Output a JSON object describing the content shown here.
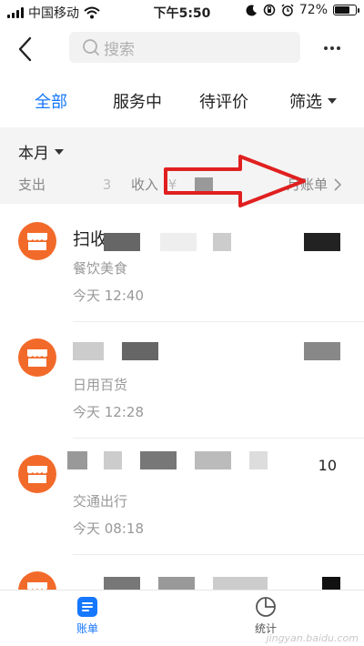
{
  "status_bar": {
    "carrier": "中国移动",
    "time": "下午5:50",
    "battery": "72%",
    "battery_level": 0.72
  },
  "search": {
    "placeholder": "搜索"
  },
  "tabs": [
    {
      "label": "全部",
      "active": true
    },
    {
      "label": "服务中"
    },
    {
      "label": "待评价"
    },
    {
      "label": "筛选"
    }
  ],
  "month": {
    "title": "本月",
    "expense_label": "支出",
    "expense_fragment": "3",
    "income_label": "收入",
    "income_fragment": "¥",
    "bill_link": "月账单"
  },
  "transactions": [
    {
      "title": "扫收",
      "category": "餐饮美食",
      "time": "今天  12:40"
    },
    {
      "title": "",
      "category": "日用百货",
      "time": "今天  12:28"
    },
    {
      "title": "",
      "category": "交通出行",
      "time": "今天  08:18",
      "amount_fragment": "10"
    },
    {
      "title": "",
      "category": "",
      "time": ""
    }
  ],
  "bottom_nav": {
    "bills": "账单",
    "stats": "统计"
  },
  "watermark": "jingyan.baidu.com",
  "colors": {
    "accent": "#1677ff",
    "merchant_icon": "#f26a2a",
    "annotation_arrow": "#e02020"
  }
}
